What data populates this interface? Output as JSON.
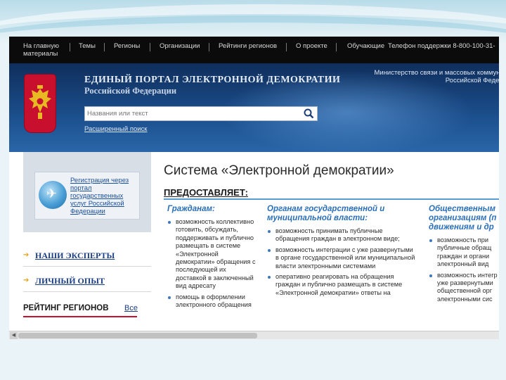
{
  "topnav": {
    "items": [
      "На главную",
      "Темы",
      "Регионы",
      "Организации",
      "Рейтинги регионов",
      "О проекте",
      "Обучающие материалы",
      "Телефон поддержки 8-800-100-31-"
    ],
    "item_first_line2": "материалы"
  },
  "header": {
    "title": "ЕДИНЫЙ ПОРТАЛ ЭЛЕКТРОННОЙ ДЕМОКРАТИИ",
    "subtitle": "Российской Федерации",
    "ministry": [
      "Министерство связи и массовых коммуник",
      "Российской Федера"
    ],
    "search": {
      "placeholder": "Названия или текст"
    },
    "advanced_search": "Расширенный поиск"
  },
  "sidebar": {
    "promo": "Регистрация через портал государственных услуг Российской Федерации",
    "links": [
      "НАШИ ЭКСПЕРТЫ",
      "ЛИЧНЫЙ ОПЫТ"
    ],
    "rating_title": "РЕЙТИНГ РЕГИОНОВ",
    "rating_link": "Все"
  },
  "main": {
    "title": "Система «Электронной демократии»",
    "provides": "ПРЕДОСТАВЛЯЕТ:",
    "columns": [
      {
        "heading": "Гражданам:",
        "items": [
          "возможность коллективно готовить, обсуждать, поддерживать и публично размещать в системе «Электронной демократии» обращения с последующей их доставкой в заключенный вид адресату",
          "помощь в оформлении электронного обращения"
        ]
      },
      {
        "heading": "Органам государственной и муниципальной власти:",
        "items": [
          "возможность принимать публичные обращения граждан в электронном виде;",
          "возможность интеграции с уже развернутыми в органе государственной или муниципальной власти электронными системами",
          "оперативно реагировать на обращения граждан и публично размещать в системе «Электронной демократии» ответы на"
        ]
      },
      {
        "heading": "Общественным организациям (п движениям и др",
        "items": [
          "возможность при публичные обращ граждан и органи электронный вид",
          "возможность интегр уже развернутыми общественной орг электронными сис"
        ]
      }
    ]
  },
  "colors": {
    "nav_bg": "#0b0b0b",
    "header_bg": "#1c4f8d",
    "accent_blue": "#2a6fb8",
    "rating_red": "#c8102e"
  }
}
